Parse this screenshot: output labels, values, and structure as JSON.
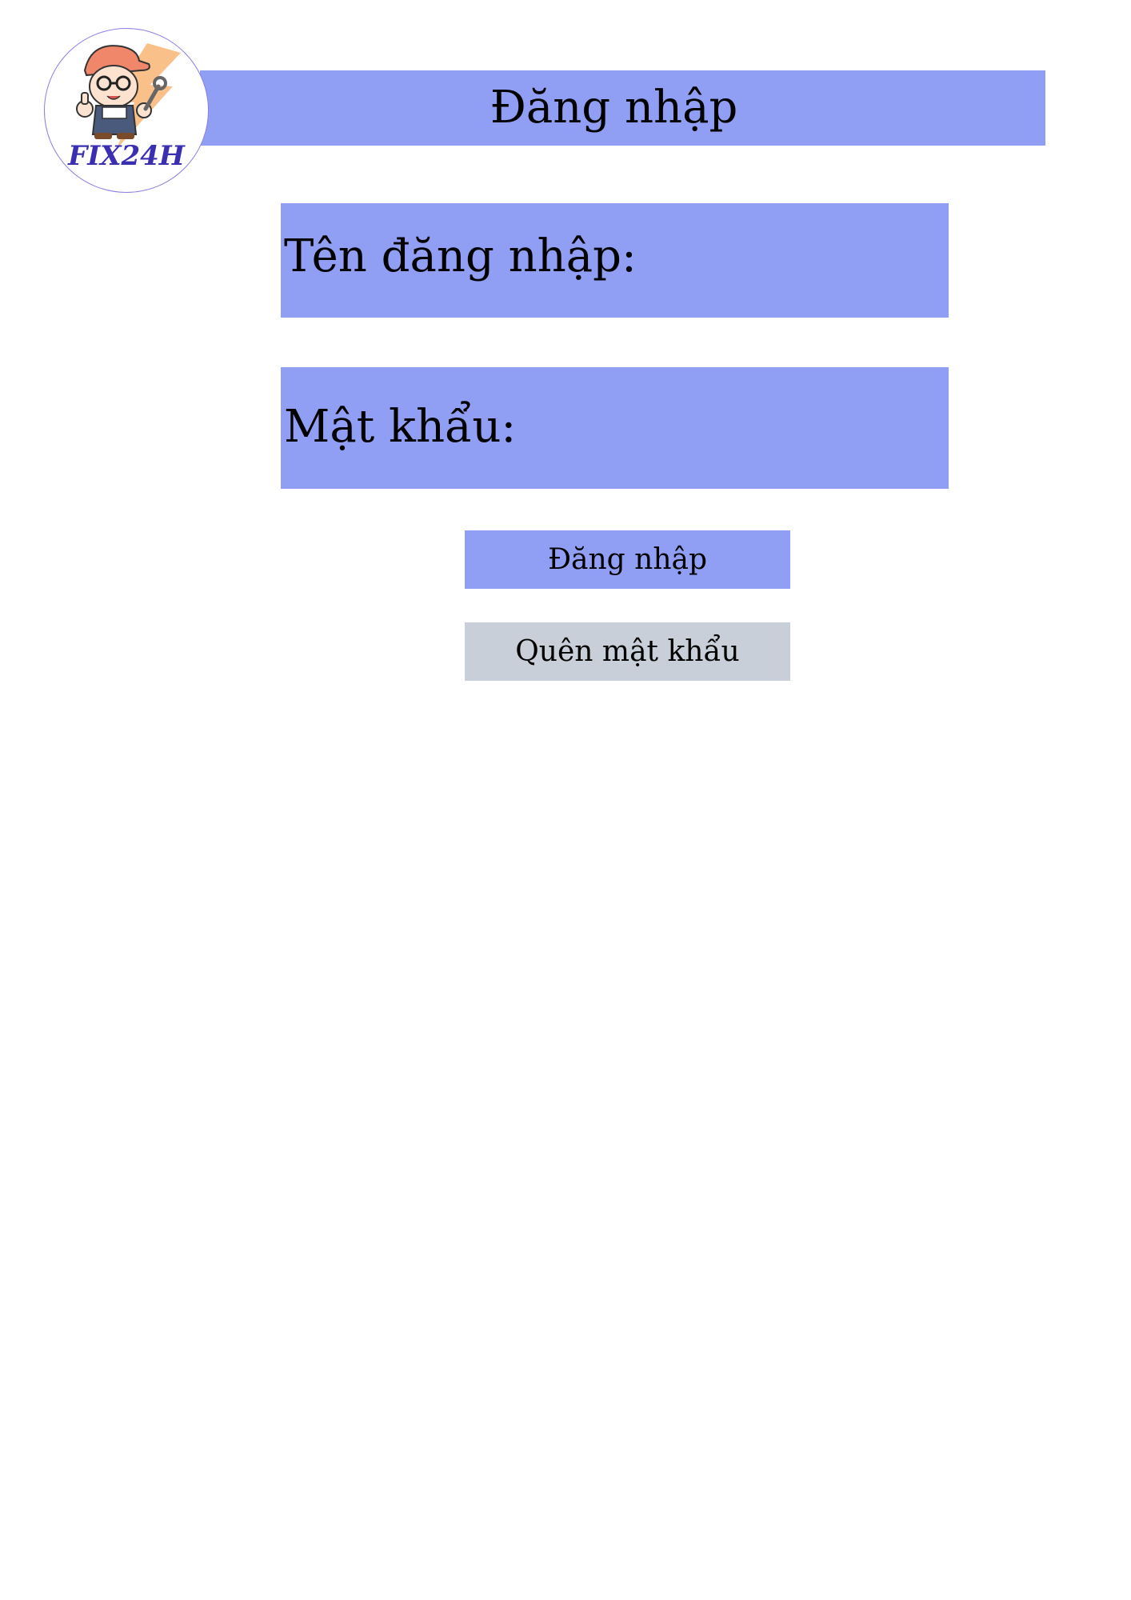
{
  "header": {
    "title": "Đăng nhập"
  },
  "logo": {
    "brand_text": "FIX24H",
    "icon": "mechanic-mascot-logo"
  },
  "form": {
    "username_label": "Tên đăng nhập:",
    "password_label": "Mật khẩu:"
  },
  "buttons": {
    "login_label": "Đăng nhập",
    "forgot_label": "Quên mật khẩu"
  },
  "colors": {
    "accent": "#909ff4",
    "secondary_button": "#c9cfd8",
    "logo_text": "#3a2fb0",
    "background": "#ffffff"
  }
}
